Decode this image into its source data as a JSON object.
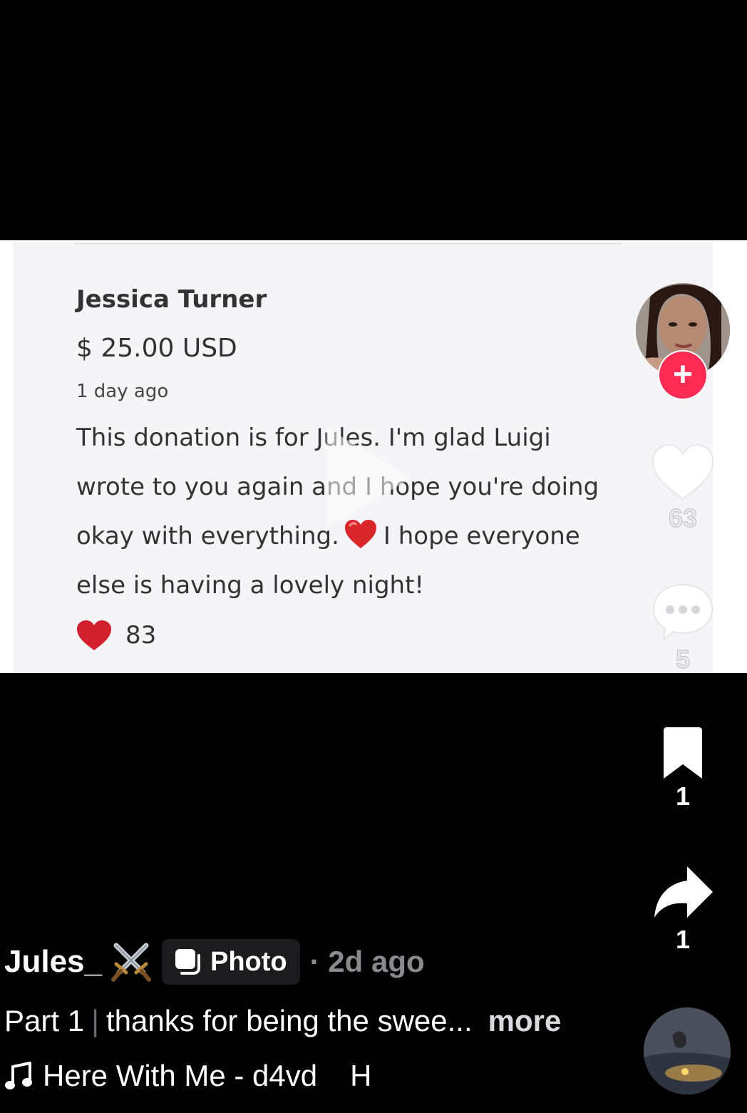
{
  "donation_card": {
    "donor_name": "Jessica Turner",
    "amount": "$ 25.00 USD",
    "time": "1 day ago",
    "message_lines": [
      "This donation is for Jules. I'm glad Luigi",
      "wrote to you again and I hope you're doing",
      "okay with everything.",
      "I hope everyone",
      "else is having a lovely night!"
    ],
    "likes": "83",
    "heart_color": "#d3202e"
  },
  "rail": {
    "avatar_icon": "creator-avatar",
    "follow_label": "+",
    "like_count": "63",
    "comment_count": "5",
    "bookmark_count": "1",
    "share_count": "1",
    "follow_color": "#fe2c55"
  },
  "post": {
    "author": "Jules_",
    "author_badge_icon": "crossed-swords-icon",
    "type_label": "Photo",
    "age": "· 2d ago",
    "description_part": "Part 1",
    "description_separator": "|",
    "description_text": "thanks for being the swee...",
    "more_label": "more",
    "music_title": "Here With Me - d4vd",
    "music_ghost": "H"
  }
}
